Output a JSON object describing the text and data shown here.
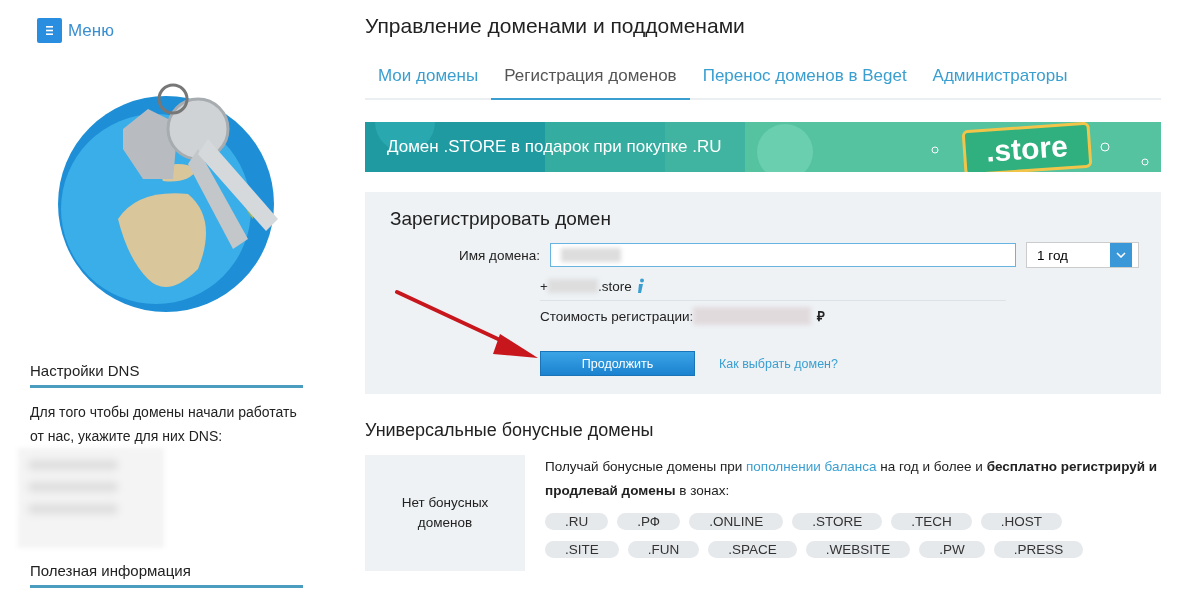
{
  "menu_button": {
    "label": "Меню"
  },
  "sidebar": {
    "sections": [
      {
        "title": "Настройки DNS",
        "text": "Для того чтобы домены начали работать от нас, укажите для них DNS:",
        "redacted": true
      },
      {
        "title": "Полезная информация"
      }
    ]
  },
  "page_title": "Управление доменами и поддоменами",
  "tabs": [
    {
      "label": "Мои домены",
      "selected": false
    },
    {
      "label": "Регистрация доменов",
      "selected": true
    },
    {
      "label": "Перенос доменов в Beget",
      "selected": false
    },
    {
      "label": "Администраторы",
      "selected": false
    }
  ],
  "banner": {
    "text": "Домен .STORE в подарок при покупке .RU",
    "sign": ".store"
  },
  "register": {
    "title": "Зарегистрировать домен",
    "domain_label": "Имя домена:",
    "period": "1 год",
    "bonus_prefix": "+",
    "bonus_suffix": ".store",
    "cost_label": "Стоимость регистрации:",
    "currency": "₽",
    "continue_button": "Продолжить",
    "help_link": "Как выбрать домен?"
  },
  "bonus": {
    "title": "Универсальные бонусные домены",
    "empty_text": "Нет бонусных доменов",
    "text_before": "Получай бонусные домены при ",
    "link": "пополнении баланса",
    "text_after": " на год и более и **бесплатно регистрируй и продлевай домены** в зонах:",
    "zones": [
      ".RU",
      ".РФ",
      ".ONLINE",
      ".STORE",
      ".TECH",
      ".HOST",
      ".SITE",
      ".FUN",
      ".SPACE",
      ".WEBSITE",
      ".PW",
      ".PRESS"
    ]
  }
}
